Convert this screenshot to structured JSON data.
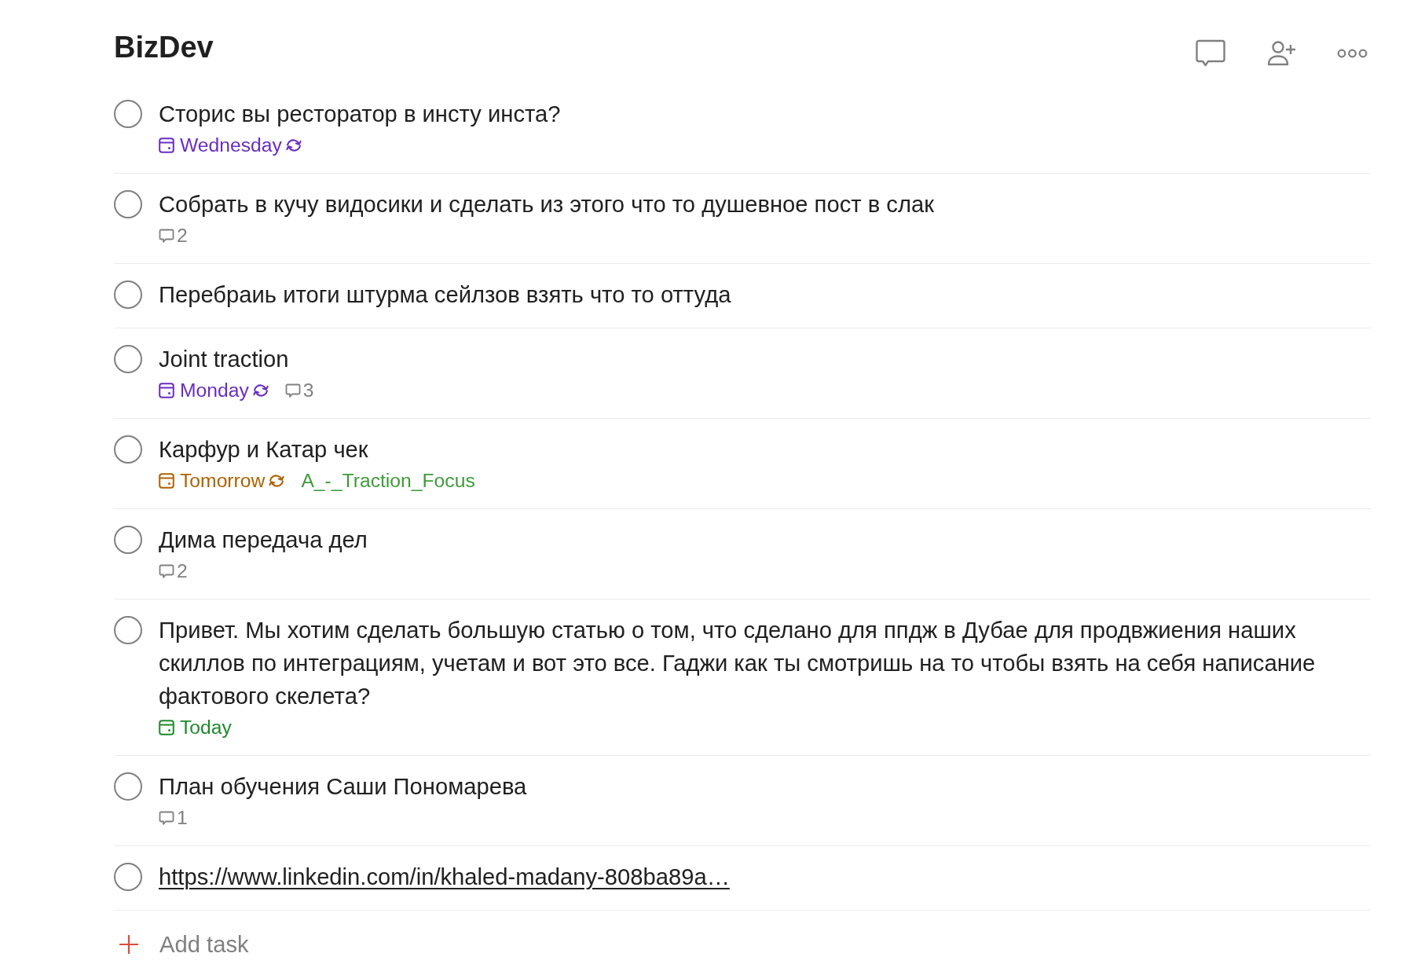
{
  "project": {
    "title": "BizDev"
  },
  "tasks": [
    {
      "kind": "text",
      "title": "Сторис вы ресторатор в инсту инста?",
      "checked": false,
      "due": {
        "text": "Wednesday",
        "color": "#692fc2",
        "recurring": true
      }
    },
    {
      "kind": "text",
      "title": "Собрать в кучу видосики и сделать из этого что то душевное пост в слак",
      "checked": false,
      "comments": "2"
    },
    {
      "kind": "text",
      "title": "Перебраиь итоги штурма сейлзов взять что то оттуда",
      "checked": false
    },
    {
      "kind": "text",
      "title": "Joint traction",
      "checked": false,
      "due": {
        "text": "Monday",
        "color": "#692fc2",
        "recurring": true
      },
      "comments": "3"
    },
    {
      "kind": "text",
      "title": "Карфур и Катар чек",
      "checked": false,
      "due": {
        "text": "Tomorrow",
        "color": "#ad6200",
        "recurring": true
      },
      "labels": [
        {
          "text": "A_-_Traction_Focus",
          "color": "#3f9a3a"
        }
      ]
    },
    {
      "kind": "text",
      "title": "Дима передача дел",
      "checked": false,
      "comments": "2"
    },
    {
      "kind": "text",
      "title": "Привет. Мы хотим сделать большую статью о том, что сделано для ппдж в Дубае для продвжиения наших скиллов по интеграциям, учетам и вот это все. Гаджи как ты смотришь на то чтобы взять на себя написание фактового скелета?",
      "checked": false,
      "due": {
        "text": "Today",
        "color": "#1f8a2c"
      }
    },
    {
      "kind": "text",
      "title": "План обучения Саши Пономарева",
      "checked": false,
      "comments": "1"
    },
    {
      "kind": "link",
      "title": "https://www.linkedin.com/in/khaled-madany-808ba89a…",
      "checked": false
    }
  ],
  "add_task": {
    "label": "Add task"
  }
}
